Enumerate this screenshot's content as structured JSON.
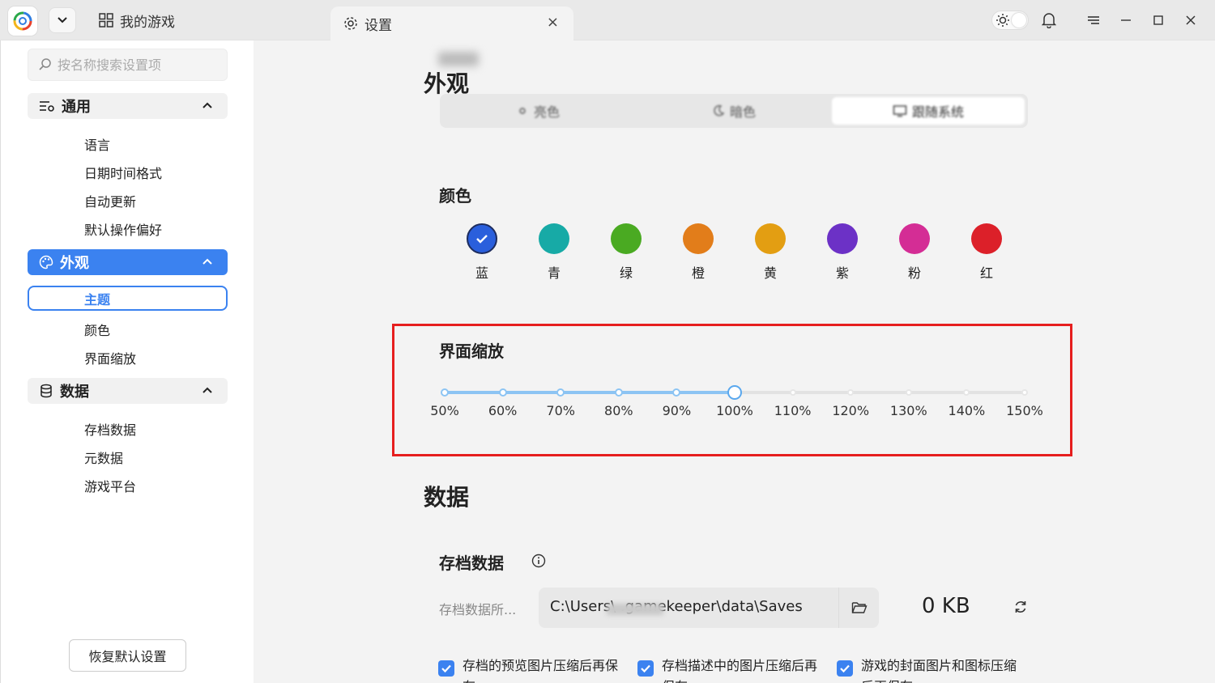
{
  "titlebar": {
    "games_tab_label": "我的游戏",
    "settings_tab_label": "设置",
    "close_tab": "×"
  },
  "sidebar": {
    "search_placeholder": "按名称搜索设置项",
    "groups": [
      {
        "label": "通用",
        "items": [
          "语言",
          "日期时间格式",
          "自动更新",
          "默认操作偏好"
        ]
      },
      {
        "label": "外观",
        "items": [
          "主题",
          "颜色",
          "界面缩放"
        ]
      },
      {
        "label": "数据",
        "items": [
          "存档数据",
          "元数据",
          "游戏平台"
        ]
      }
    ],
    "reset_label": "恢复默认设置"
  },
  "main": {
    "appearance_title": "外观",
    "theme_options": [
      "亮色",
      "暗色",
      "跟随系统"
    ],
    "color_title": "颜色",
    "colors": [
      {
        "name": "蓝",
        "hex": "#2a5fdc",
        "selected": true
      },
      {
        "name": "青",
        "hex": "#17aaa6"
      },
      {
        "name": "绿",
        "hex": "#4aaa22"
      },
      {
        "name": "橙",
        "hex": "#e27d1a"
      },
      {
        "name": "黄",
        "hex": "#e39e12"
      },
      {
        "name": "紫",
        "hex": "#6c31c6"
      },
      {
        "name": "粉",
        "hex": "#d42d95"
      },
      {
        "name": "红",
        "hex": "#dc2029"
      }
    ],
    "scale_title": "界面缩放",
    "scale_ticks": [
      "50%",
      "60%",
      "70%",
      "80%",
      "90%",
      "100%",
      "110%",
      "120%",
      "130%",
      "140%",
      "150%"
    ],
    "scale_value": "100%",
    "data_title": "数据",
    "save_data_title": "存档数据",
    "save_path_label": "存档数据所...",
    "save_path_value": "C:\\Users\\      .gamekeeper\\data\\Saves",
    "save_size": "0 KB",
    "checkboxes": [
      {
        "label": "存档的预览图片压缩后再保存",
        "checked": true
      },
      {
        "label": "存档描述中的图片压缩后再保存",
        "checked": true
      },
      {
        "label": "游戏的封面图片和图标压缩后再保存",
        "checked": true
      }
    ]
  }
}
